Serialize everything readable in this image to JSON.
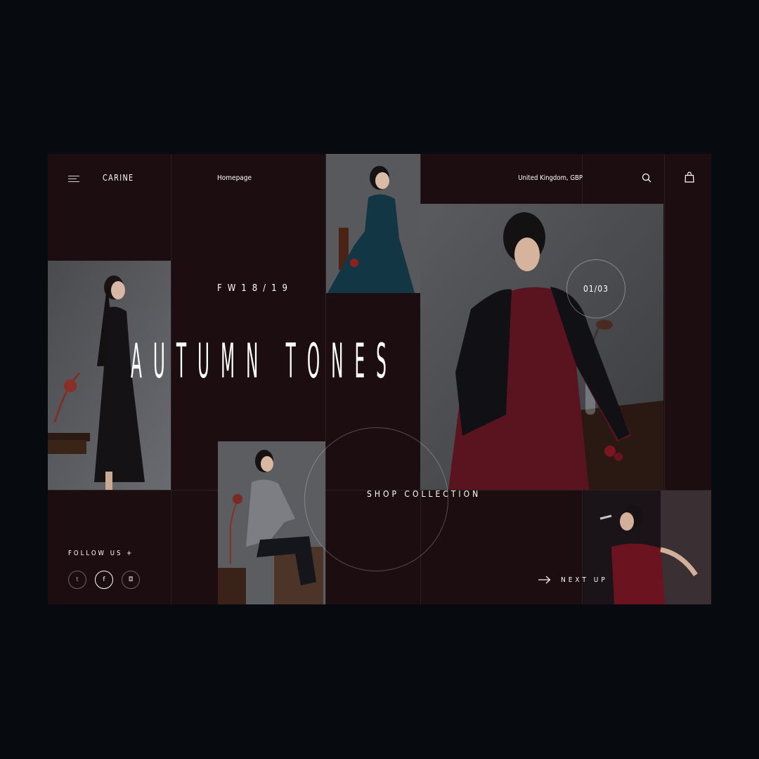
{
  "header": {
    "brand": "CARINE",
    "nav_home": "Homepage",
    "region": "United Kingdom, GBP",
    "menu_icon": "hamburger-icon",
    "search_icon": "search-icon",
    "cart_icon": "shopping-bag-icon"
  },
  "hero": {
    "season": "FW18/19",
    "headline": "AUTUMN TONES",
    "slide_counter": "01/03",
    "cta": "SHOP COLLECTION"
  },
  "social": {
    "label": "FOLLOW US +",
    "items": [
      {
        "icon": "twitter-icon",
        "glyph": "t",
        "active": false
      },
      {
        "icon": "facebook-icon",
        "glyph": "f",
        "active": true
      },
      {
        "icon": "instagram-icon",
        "glyph": "◘",
        "active": false
      }
    ]
  },
  "next": {
    "label": "NEXT UP",
    "icon": "arrow-right-icon"
  },
  "colors": {
    "background": "#070b10",
    "panel": "#1c0e10",
    "accent_wine": "#6a1620",
    "photo_grey": "#55565a",
    "text": "#ffffff"
  }
}
